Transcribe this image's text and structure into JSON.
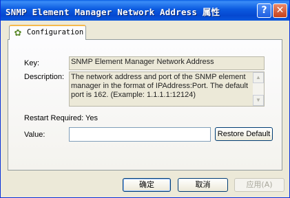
{
  "window": {
    "title": "SNMP Element Manager Network Address 属性",
    "help_glyph": "?",
    "close_glyph": "✕",
    "help_icon": "help-icon",
    "close_icon": "close-icon"
  },
  "tabs": [
    {
      "label": "Configuration",
      "icon": "configuration-icon",
      "selected": true
    }
  ],
  "fields": {
    "key_label": "Key:",
    "key_value": "SNMP Element Manager Network Address",
    "description_label": "Description:",
    "description_value": "The network address and port of the SNMP element manager in the format of IPAddress:Port. The default port is 162. (Example: 1.1.1.1:12124)",
    "restart_label": "Restart Required:",
    "restart_value": "Yes",
    "value_label": "Value:",
    "value_input": ""
  },
  "buttons": {
    "restore_default": "Restore Default",
    "ok": "确定",
    "cancel": "取消",
    "apply": "应用(A)"
  },
  "colors": {
    "titlebar": "#0a5fe5",
    "dialog_bg": "#ece9d8",
    "tab_highlight": "#f6b94a"
  }
}
